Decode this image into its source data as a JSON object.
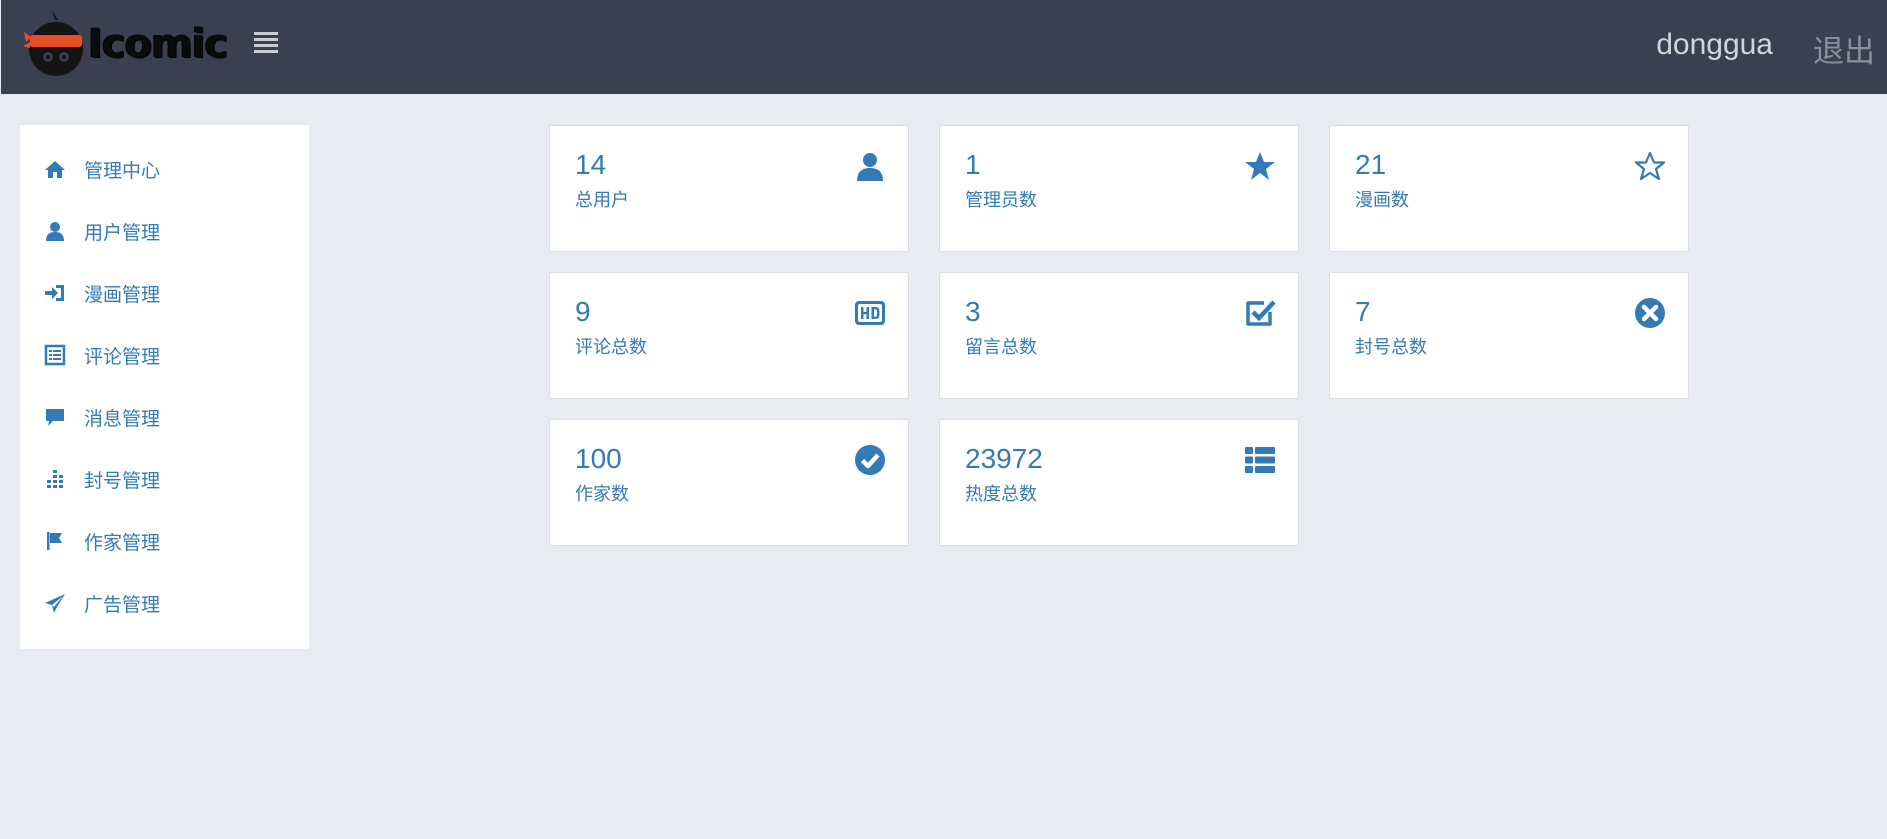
{
  "header": {
    "logo_text": "Icomic",
    "username": "donggua",
    "logout_label": "退出"
  },
  "sidebar": {
    "items": [
      {
        "label": "管理中心",
        "icon": "home-icon"
      },
      {
        "label": "用户管理",
        "icon": "user-icon"
      },
      {
        "label": "漫画管理",
        "icon": "log-in-icon"
      },
      {
        "label": "评论管理",
        "icon": "list-alt-icon"
      },
      {
        "label": "消息管理",
        "icon": "comment-icon"
      },
      {
        "label": "封号管理",
        "icon": "tasks-icon"
      },
      {
        "label": "作家管理",
        "icon": "flag-icon"
      },
      {
        "label": "广告管理",
        "icon": "send-icon"
      }
    ]
  },
  "stats": [
    {
      "value": "14",
      "label": "总用户",
      "icon": "user-icon"
    },
    {
      "value": "1",
      "label": "管理员数",
      "icon": "star-icon"
    },
    {
      "value": "21",
      "label": "漫画数",
      "icon": "star-empty-icon"
    },
    {
      "value": "9",
      "label": "评论总数",
      "icon": "hd-video-icon"
    },
    {
      "value": "3",
      "label": "留言总数",
      "icon": "check-icon"
    },
    {
      "value": "7",
      "label": "封号总数",
      "icon": "remove-sign-icon"
    },
    {
      "value": "100",
      "label": "作家数",
      "icon": "ok-sign-icon"
    },
    {
      "value": "23972",
      "label": "热度总数",
      "icon": "th-list-icon"
    }
  ],
  "colors": {
    "accent": "#337ab7",
    "topbar": "#3a3f52",
    "background": "#e8ebf2"
  }
}
